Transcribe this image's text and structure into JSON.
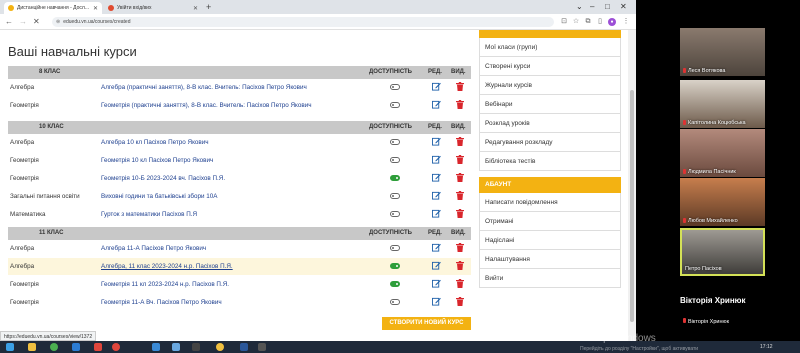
{
  "browser": {
    "tabs": [
      {
        "label": "Дистанційне навчання - Досл...",
        "active": true
      },
      {
        "label": "Увійти вхід/вих",
        "active": false
      }
    ],
    "url": "eduedu.vn.ua/courses/created",
    "status_url": "https://eduedu.vn.ua/courses/view/1372"
  },
  "page": {
    "title": "Ваші навчальні курси",
    "columns": {
      "availability": "ДОСТУПНІСТЬ",
      "edit": "РЕД.",
      "delete": "ВИД."
    },
    "sections": [
      {
        "name": "8 КЛАС",
        "rows": [
          {
            "subject": "Алгебра",
            "course": "Алгебра (практичні заняття), 8-В клас. Вчитель: Пасіхов Петро Якович",
            "available": false,
            "highlight": false,
            "underline": false
          },
          {
            "subject": "Геометрія",
            "course": "Геометрія (практичні заняття), 8-В клас. Вчитель: Пасіхов Петро Якович",
            "available": false,
            "highlight": false,
            "underline": false
          }
        ]
      },
      {
        "name": "10 КЛАС",
        "rows": [
          {
            "subject": "Алгебра",
            "course": "Алгебра 10 кл Пасіхов Петро Якович",
            "available": false,
            "highlight": false,
            "underline": false
          },
          {
            "subject": "Геометрія",
            "course": "Геометрія 10 кл Пасіхов Петро Якович",
            "available": false,
            "highlight": false,
            "underline": false
          },
          {
            "subject": "Геометрія",
            "course": "Геометрія 10-Б 2023-2024 вч. Пасіхов П.Я.",
            "available": true,
            "highlight": false,
            "underline": false
          },
          {
            "subject": "Загальні питання освіти",
            "course": "Виховні години та батьківські збори 10А",
            "available": false,
            "highlight": false,
            "underline": false
          },
          {
            "subject": "Математика",
            "course": "Гурток з математики Пасіхов П.Я",
            "available": false,
            "highlight": false,
            "underline": false
          }
        ]
      },
      {
        "name": "11 КЛАС",
        "rows": [
          {
            "subject": "Алгебра",
            "course": "Алгебра 11-А Пасіхов Петро Якович",
            "available": false,
            "highlight": false,
            "underline": false
          },
          {
            "subject": "Алгебра",
            "course": "Алгебра, 11 клас 2023-2024 н.р. Пасіхов П.Я.",
            "available": true,
            "highlight": true,
            "underline": true
          },
          {
            "subject": "Геометрія",
            "course": "Геометрія 11 кл 2023-2024 н.р. Пасіхов П.Я.",
            "available": true,
            "highlight": false,
            "underline": false
          },
          {
            "subject": "Геометрія",
            "course": "Геометрія 11-А Вч. Пасіхов Петро Якович",
            "available": false,
            "highlight": false,
            "underline": false
          }
        ]
      }
    ],
    "create_button": "СТВОРИТИ НОВИЙ КУРС"
  },
  "sidemenu": {
    "top_items": [
      "Мої класи (групи)",
      "Створені курси",
      "Журнали курсів",
      "Вебінари",
      "Розклад уроків",
      "Редагування розкладу",
      "Бібліотека тестів"
    ],
    "about_header": "АБАУНТ",
    "about_items": [
      "Написати повідомлення",
      "Отримані",
      "Надіслані",
      "Налаштування",
      "Вийти"
    ]
  },
  "video": {
    "participants": [
      "Леся Вотякова",
      "Капітолина Коцюбська",
      "Людмила Пасічник",
      "Любов Михайленко",
      "Петро Пасіхов"
    ],
    "active_participant": "Петро Пасіхов",
    "speaker": "Вікторія Хринюк",
    "speaker_label": "Вікторія Хринюк"
  },
  "windows": {
    "activate_title": "Активація Windows",
    "activate_sub": "Перейдіть до розділу \"Настройки\", щоб активувати",
    "time": "17:12",
    "date": "07.12.2023"
  },
  "colors": {
    "accent": "#f3b212",
    "link": "#1d3f8f",
    "header": "#c8c8c8",
    "toggle_on": "#2e9e3a",
    "delete": "#d9262c",
    "edit": "#1d5fa8"
  }
}
